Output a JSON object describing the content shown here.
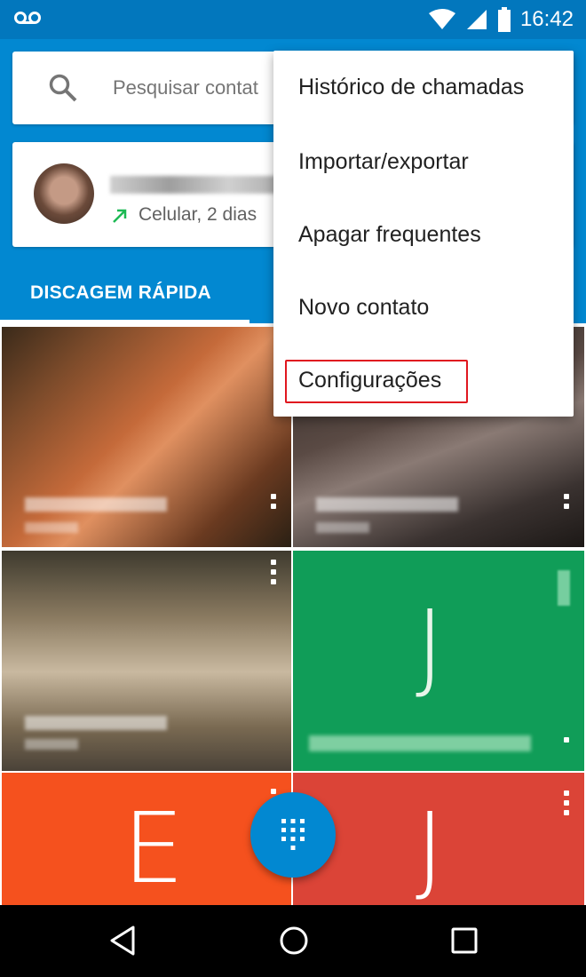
{
  "status_bar": {
    "time": "16:42",
    "icons": [
      "voicemail-icon",
      "wifi-icon",
      "signal-icon",
      "battery-icon"
    ]
  },
  "search": {
    "placeholder": "Pesquisar contat"
  },
  "recent_call": {
    "call_info": "Celular, 2 dias"
  },
  "tabs": {
    "speed_dial": "DISCAGEM RÁPIDA"
  },
  "tiles": [
    {
      "letter": ""
    },
    {
      "letter": ""
    },
    {
      "letter": ""
    },
    {
      "letter": "J",
      "color": "#109d58"
    },
    {
      "letter": "E",
      "color": "#f5511e"
    },
    {
      "letter": "J",
      "color": "#db4437"
    }
  ],
  "menu": {
    "items": [
      "Histórico de chamadas",
      "Importar/exportar",
      "Apagar frequentes",
      "Novo contato",
      "Configurações"
    ],
    "highlighted": "Configurações"
  },
  "colors": {
    "status_bar": "#0277bd",
    "header": "#0288d1",
    "highlight": "#e0171f"
  }
}
